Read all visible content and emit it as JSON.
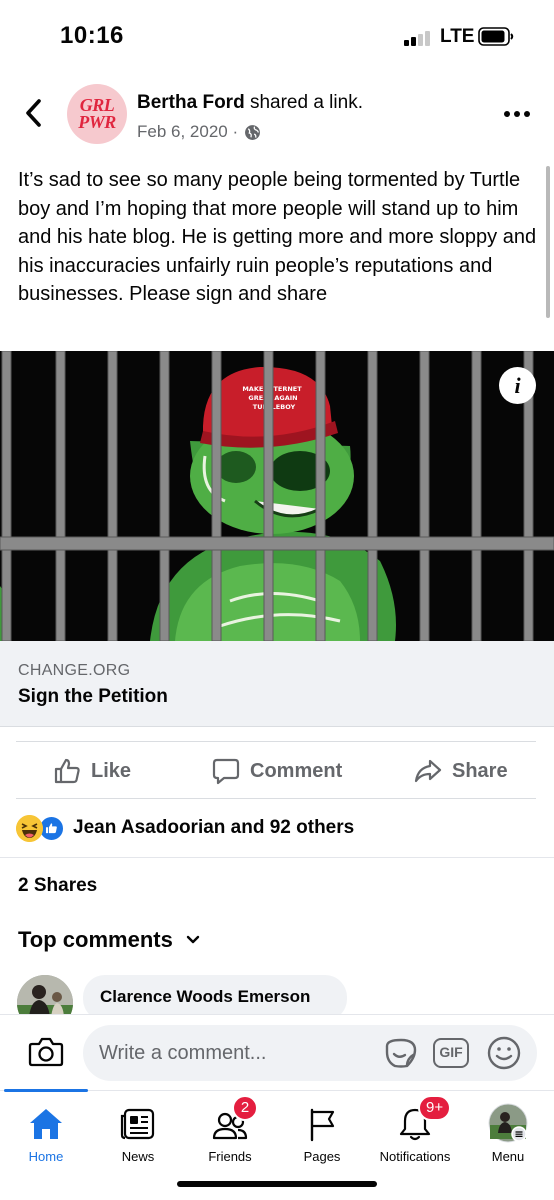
{
  "status_bar": {
    "time": "10:16",
    "network": "LTE"
  },
  "post": {
    "author": "Bertha Ford",
    "action": " shared a link.",
    "avatar_line1": "GRL",
    "avatar_line2": "PWR",
    "date": "Feb 6, 2020 ·",
    "text": "It’s sad to see so many people being tormented by Turtle boy and I’m hoping that more people will stand up to him and his hate blog. He is getting more and more sloppy and his inaccuracies unfairly ruin people’s reputations and businesses. Please sign and share",
    "link": {
      "hat_line1": "MAKE INTERNET",
      "hat_line2": "GREAT AGAIN",
      "hat_line3": "TURTLEBOY",
      "info_symbol": "i",
      "domain": "CHANGE.ORG",
      "title": "Sign the Petition"
    }
  },
  "actions": {
    "like": "Like",
    "comment": "Comment",
    "share": "Share"
  },
  "reactions": {
    "text": "Jean Asadoorian and 92 others",
    "types": [
      "haha",
      "like"
    ]
  },
  "shares": "2 Shares",
  "comments": {
    "heading": "Top comments",
    "first_author": "Clarence Woods Emerson"
  },
  "composer": {
    "placeholder": "Write a comment...",
    "gif_label": "GIF"
  },
  "tabs": [
    {
      "label": "Home",
      "icon": "home-icon",
      "active": true
    },
    {
      "label": "News",
      "icon": "news-icon"
    },
    {
      "label": "Friends",
      "icon": "friends-icon",
      "badge": "2"
    },
    {
      "label": "Pages",
      "icon": "flag-icon"
    },
    {
      "label": "Notifications",
      "icon": "bell-icon",
      "badge": "9+"
    },
    {
      "label": "Menu",
      "icon": "profile-menu-icon"
    }
  ],
  "colors": {
    "accent": "#1b74e4",
    "badge": "#e41e3f",
    "secondary_text": "#65676b",
    "caption_bg": "#f0f2f5"
  }
}
